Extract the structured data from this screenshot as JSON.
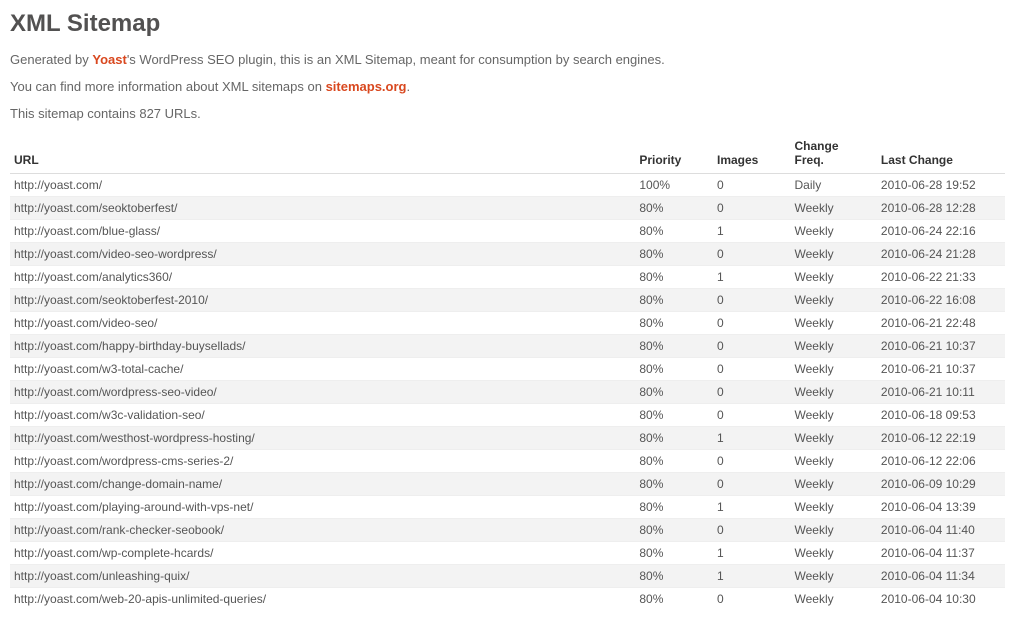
{
  "title": "XML Sitemap",
  "intro": {
    "prefix": "Generated by ",
    "brand": "Yoast",
    "suffix": "'s WordPress SEO plugin, this is an XML Sitemap, meant for consumption by search engines."
  },
  "info": {
    "prefix": "You can find more information about XML sitemaps on ",
    "link": "sitemaps.org",
    "suffix": "."
  },
  "count_line": "This sitemap contains 827 URLs.",
  "headers": {
    "url": "URL",
    "priority": "Priority",
    "images": "Images",
    "freq": "Change Freq.",
    "last": "Last Change"
  },
  "rows": [
    {
      "url": "http://yoast.com/",
      "priority": "100%",
      "images": "0",
      "freq": "Daily",
      "last": "2010-06-28 19:52"
    },
    {
      "url": "http://yoast.com/seoktoberfest/",
      "priority": "80%",
      "images": "0",
      "freq": "Weekly",
      "last": "2010-06-28 12:28"
    },
    {
      "url": "http://yoast.com/blue-glass/",
      "priority": "80%",
      "images": "1",
      "freq": "Weekly",
      "last": "2010-06-24 22:16"
    },
    {
      "url": "http://yoast.com/video-seo-wordpress/",
      "priority": "80%",
      "images": "0",
      "freq": "Weekly",
      "last": "2010-06-24 21:28"
    },
    {
      "url": "http://yoast.com/analytics360/",
      "priority": "80%",
      "images": "1",
      "freq": "Weekly",
      "last": "2010-06-22 21:33"
    },
    {
      "url": "http://yoast.com/seoktoberfest-2010/",
      "priority": "80%",
      "images": "0",
      "freq": "Weekly",
      "last": "2010-06-22 16:08"
    },
    {
      "url": "http://yoast.com/video-seo/",
      "priority": "80%",
      "images": "0",
      "freq": "Weekly",
      "last": "2010-06-21 22:48"
    },
    {
      "url": "http://yoast.com/happy-birthday-buysellads/",
      "priority": "80%",
      "images": "0",
      "freq": "Weekly",
      "last": "2010-06-21 10:37"
    },
    {
      "url": "http://yoast.com/w3-total-cache/",
      "priority": "80%",
      "images": "0",
      "freq": "Weekly",
      "last": "2010-06-21 10:37"
    },
    {
      "url": "http://yoast.com/wordpress-seo-video/",
      "priority": "80%",
      "images": "0",
      "freq": "Weekly",
      "last": "2010-06-21 10:11"
    },
    {
      "url": "http://yoast.com/w3c-validation-seo/",
      "priority": "80%",
      "images": "0",
      "freq": "Weekly",
      "last": "2010-06-18 09:53"
    },
    {
      "url": "http://yoast.com/westhost-wordpress-hosting/",
      "priority": "80%",
      "images": "1",
      "freq": "Weekly",
      "last": "2010-06-12 22:19"
    },
    {
      "url": "http://yoast.com/wordpress-cms-series-2/",
      "priority": "80%",
      "images": "0",
      "freq": "Weekly",
      "last": "2010-06-12 22:06"
    },
    {
      "url": "http://yoast.com/change-domain-name/",
      "priority": "80%",
      "images": "0",
      "freq": "Weekly",
      "last": "2010-06-09 10:29"
    },
    {
      "url": "http://yoast.com/playing-around-with-vps-net/",
      "priority": "80%",
      "images": "1",
      "freq": "Weekly",
      "last": "2010-06-04 13:39"
    },
    {
      "url": "http://yoast.com/rank-checker-seobook/",
      "priority": "80%",
      "images": "0",
      "freq": "Weekly",
      "last": "2010-06-04 11:40"
    },
    {
      "url": "http://yoast.com/wp-complete-hcards/",
      "priority": "80%",
      "images": "1",
      "freq": "Weekly",
      "last": "2010-06-04 11:37"
    },
    {
      "url": "http://yoast.com/unleashing-quix/",
      "priority": "80%",
      "images": "1",
      "freq": "Weekly",
      "last": "2010-06-04 11:34"
    },
    {
      "url": "http://yoast.com/web-20-apis-unlimited-queries/",
      "priority": "80%",
      "images": "0",
      "freq": "Weekly",
      "last": "2010-06-04 10:30"
    }
  ]
}
